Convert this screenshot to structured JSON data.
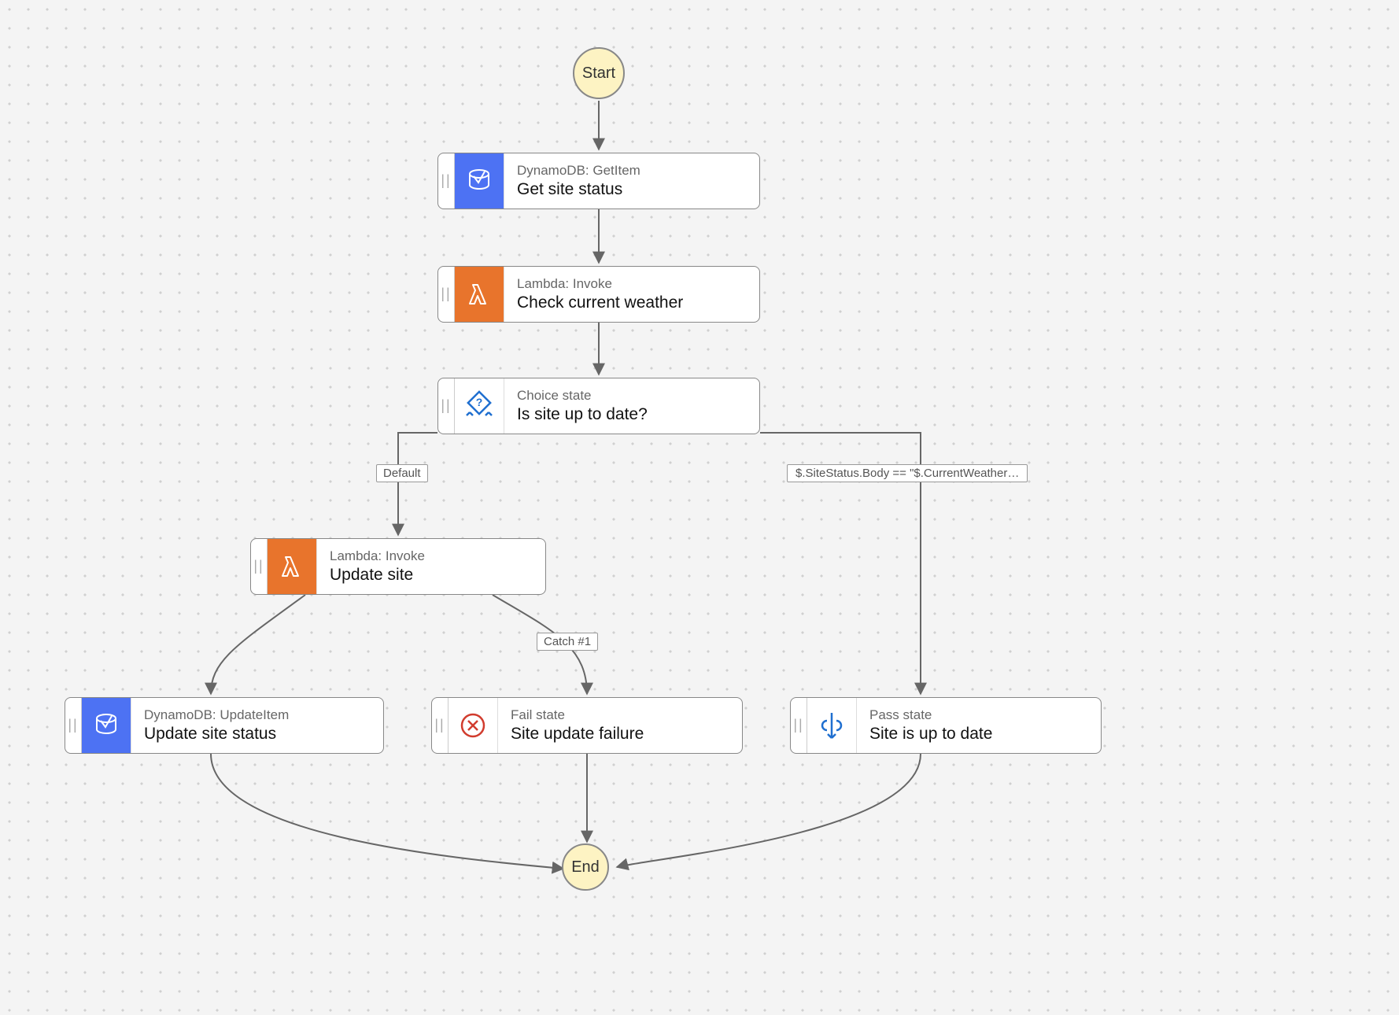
{
  "terminals": {
    "start": "Start",
    "end": "End"
  },
  "nodes": {
    "get_site_status": {
      "type": "DynamoDB: GetItem",
      "title": "Get site status"
    },
    "check_weather": {
      "type": "Lambda: Invoke",
      "title": "Check current weather"
    },
    "choice": {
      "type": "Choice state",
      "title": "Is site up to date?"
    },
    "update_site": {
      "type": "Lambda: Invoke",
      "title": "Update site"
    },
    "update_status": {
      "type": "DynamoDB: UpdateItem",
      "title": "Update site status"
    },
    "fail": {
      "type": "Fail state",
      "title": "Site update failure"
    },
    "pass": {
      "type": "Pass state",
      "title": "Site is up to date"
    }
  },
  "edge_labels": {
    "default": "Default",
    "condition": "$.SiteStatus.Body == \"$.CurrentWeather…",
    "catch": "Catch #1"
  },
  "icons": {
    "dynamodb": "dynamodb-icon",
    "lambda": "lambda-icon",
    "choice": "choice-icon",
    "fail": "fail-icon",
    "pass": "pass-icon"
  },
  "colors": {
    "dynamodb": "#4d72f3",
    "lambda": "#e8742c",
    "outline_blue": "#1f6fd0",
    "outline_red": "#d13c2e",
    "edge": "#666666"
  }
}
